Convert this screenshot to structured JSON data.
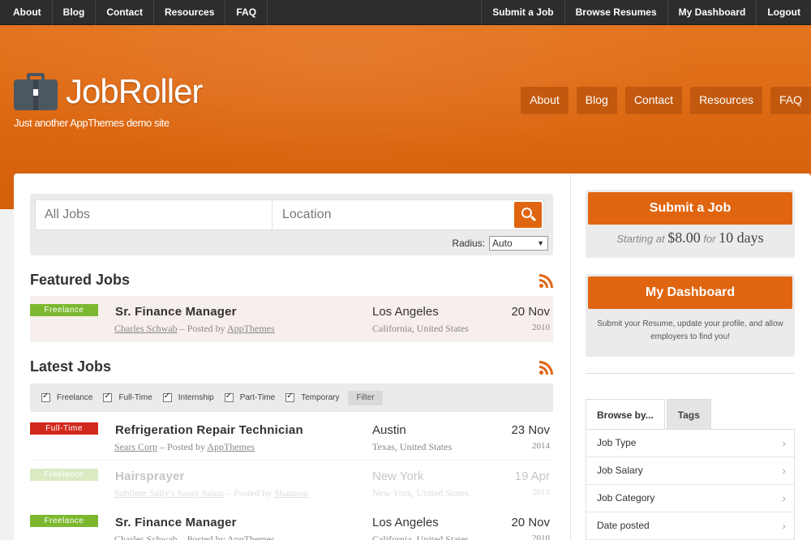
{
  "topbar": {
    "left": [
      "About",
      "Blog",
      "Contact",
      "Resources",
      "FAQ"
    ],
    "right": [
      "Submit a Job",
      "Browse Resumes",
      "My Dashboard",
      "Logout"
    ]
  },
  "header": {
    "site_name": "JobRoller",
    "tagline": "Just another AppThemes demo site",
    "nav": [
      "About",
      "Blog",
      "Contact",
      "Resources",
      "FAQ"
    ]
  },
  "search": {
    "keywords_placeholder": "All Jobs",
    "location_placeholder": "Location",
    "radius_label": "Radius:",
    "radius_value": "Auto"
  },
  "featured": {
    "heading": "Featured Jobs",
    "jobs": [
      {
        "type": "Freelance",
        "type_color": "#7cb82f",
        "title": "Sr. Finance Manager",
        "company": "Charles Schwab",
        "posted_by_text": "– Posted by",
        "poster": "AppThemes",
        "city": "Los Angeles",
        "region": "California, United States",
        "day": "20 Nov",
        "year": "2010"
      }
    ]
  },
  "latest": {
    "heading": "Latest Jobs",
    "filters": [
      "Freelance",
      "Full-Time",
      "Internship",
      "Part-Time",
      "Temporary"
    ],
    "filter_button": "Filter",
    "jobs": [
      {
        "type": "Full-Time",
        "type_color": "#d1281d",
        "title": "Refrigeration Repair Technician",
        "company": "Sears Corp",
        "posted_by_text": "– Posted by",
        "poster": "AppThemes",
        "city": "Austin",
        "region": "Texas, United States",
        "day": "23 Nov",
        "year": "2014",
        "faded": false
      },
      {
        "type": "Freelance",
        "type_color": "#7cb82f",
        "title": "Hairsprayer",
        "company": "Sublime Sally's Sassy Salon",
        "posted_by_text": "– Posted by",
        "poster": "Shannon",
        "city": "New York",
        "region": "New York, United States",
        "day": "19 Apr",
        "year": "2013",
        "faded": true
      },
      {
        "type": "Freelance",
        "type_color": "#7cb82f",
        "title": "Sr. Finance Manager",
        "company": "Charles Schwab",
        "posted_by_text": "– Posted by",
        "poster": "AppThemes",
        "city": "Los Angeles",
        "region": "California, United States",
        "day": "20 Nov",
        "year": "2010",
        "faded": false
      }
    ]
  },
  "sidebar": {
    "submit_button": "Submit a Job",
    "price_prefix": "Starting at",
    "price": "$8.00",
    "price_mid": "for",
    "duration": "10 days",
    "dashboard_button": "My Dashboard",
    "dashboard_text": "Submit your Resume, update your profile, and allow employers to find you!",
    "tabs": [
      "Browse by...",
      "Tags"
    ],
    "browse_items": [
      "Job Type",
      "Job Salary",
      "Job Category",
      "Date posted"
    ]
  },
  "colors": {
    "accent": "#e06510",
    "topbar": "#2d2d2d",
    "header": "#dc6610"
  }
}
